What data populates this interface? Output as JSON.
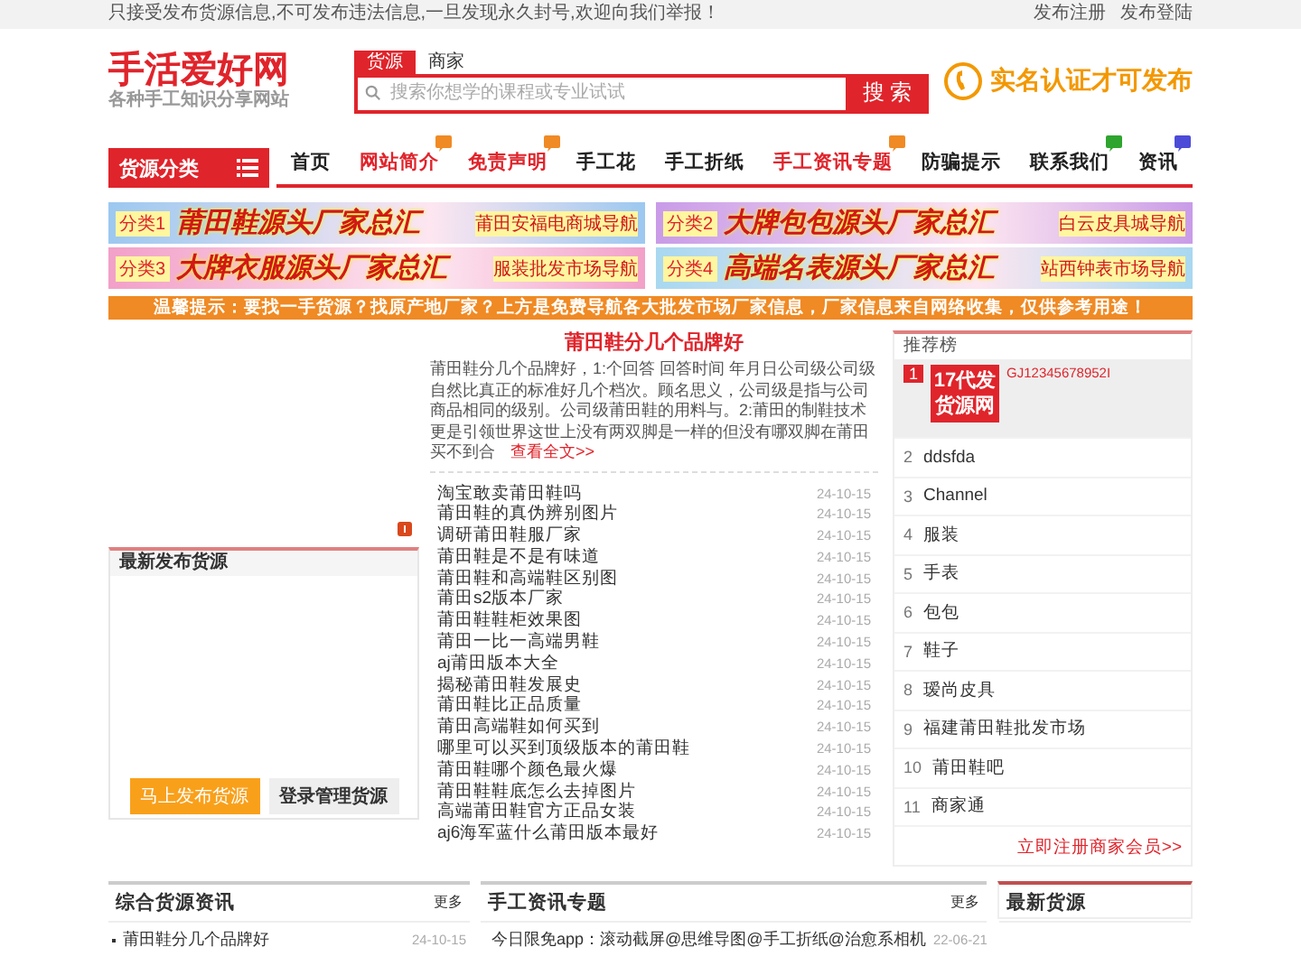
{
  "top_bar": {
    "notice": "只接受发布货源信息,不可发布违法信息,一旦发现永久封号,欢迎向我们举报！",
    "links": [
      "发布注册",
      "发布登陆"
    ]
  },
  "logo": {
    "title": "手活爱好网",
    "subtitle": "各种手工知识分享网站"
  },
  "search": {
    "tabs": [
      {
        "label": "货源",
        "selected": true
      },
      {
        "label": "商家",
        "selected": false
      }
    ],
    "placeholder": "搜索你想学的课程或专业试试",
    "button": "搜 索"
  },
  "slogan": "实名认证才可发布",
  "category_menu": "货源分类",
  "nav": [
    {
      "label": "首页",
      "highlighted": false
    },
    {
      "label": "网站简介",
      "highlighted": true,
      "color": "#f08a24"
    },
    {
      "label": "免责声明",
      "highlighted": true,
      "color": "#f08a24"
    },
    {
      "label": "手工花",
      "highlighted": false
    },
    {
      "label": "手工折纸",
      "highlighted": false
    },
    {
      "label": "手工资讯专题",
      "highlighted": true,
      "color": "#f08a24"
    },
    {
      "label": "防骗提示",
      "highlighted": false
    },
    {
      "label": "联系我们",
      "highlighted": false,
      "color": "#2ea52e"
    },
    {
      "label": "资讯",
      "highlighted": false,
      "color": "#4b4bd8"
    }
  ],
  "banners": [
    {
      "tag": "分类1",
      "title": "莆田鞋源头厂家总汇",
      "sub": "莆田安福电商城导航",
      "color": "#9cc8f0"
    },
    {
      "tag": "分类2",
      "title": "大牌包包源头厂家总汇",
      "sub": "白云皮具城导航",
      "color": "#c99be8"
    },
    {
      "tag": "分类3",
      "title": "大牌衣服源头厂家总汇",
      "sub": "服装批发市场导航",
      "color": "#f2a0c8"
    },
    {
      "tag": "分类4",
      "title": "高端名表源头厂家总汇",
      "sub": "站西钟表市场导航",
      "color": "#a8d8f0"
    }
  ],
  "notice_bar": "温馨提示：要找一手货源？找原产地厂家？上方是免费导航各大批发市场厂家信息，厂家信息来自网络收集，仅供参考用途！",
  "latest_box": {
    "title": "最新发布货源",
    "buttons": [
      "马上发布货源",
      "登录管理货源"
    ]
  },
  "article": {
    "title": "莆田鞋分几个品牌好",
    "summary": "莆田鞋分几个品牌好，1:个回答 回答时间 年月日公司级公司级自然比真正的标准好几个档次。顾名思义，公司级是指与公司商品相同的级别。公司级莆田鞋的用料与。2:莆田的制鞋技术更是引领世界这世上没有两双脚是一样的但没有哪双脚在莆田买不到合",
    "more": "查看全文>>"
  },
  "news": [
    {
      "title": "淘宝敢卖莆田鞋吗",
      "date": "24-10-15"
    },
    {
      "title": "莆田鞋的真伪辨别图片",
      "date": "24-10-15"
    },
    {
      "title": "调研莆田鞋服厂家",
      "date": "24-10-15"
    },
    {
      "title": "莆田鞋是不是有味道",
      "date": "24-10-15"
    },
    {
      "title": "莆田鞋和高端鞋区别图",
      "date": "24-10-15"
    },
    {
      "title": "莆田s2版本厂家",
      "date": "24-10-15"
    },
    {
      "title": "莆田鞋鞋柜效果图",
      "date": "24-10-15"
    },
    {
      "title": "莆田一比一高端男鞋",
      "date": "24-10-15"
    },
    {
      "title": "aj莆田版本大全",
      "date": "24-10-15"
    },
    {
      "title": "揭秘莆田鞋发展史",
      "date": "24-10-15"
    },
    {
      "title": "莆田鞋比正品质量",
      "date": "24-10-15"
    },
    {
      "title": "莆田高端鞋如何买到",
      "date": "24-10-15"
    },
    {
      "title": "哪里可以买到顶级版本的莆田鞋",
      "date": "24-10-15"
    },
    {
      "title": "莆田鞋哪个颜色最火爆",
      "date": "24-10-15"
    },
    {
      "title": "莆田鞋鞋底怎么去掉图片",
      "date": "24-10-15"
    },
    {
      "title": "高端莆田鞋官方正品女装",
      "date": "24-10-15"
    },
    {
      "title": "aj6海军蓝什么莆田版本最好",
      "date": "24-10-15"
    }
  ],
  "ranking": {
    "title": "推荐榜",
    "items": [
      {
        "rank": "1",
        "name": "GJ12345678952I",
        "logo": "17代发货源网",
        "highlighted": true
      },
      {
        "rank": "2",
        "name": "ddsfda",
        "highlighted": false
      },
      {
        "rank": "3",
        "name": "Channel",
        "highlighted": false
      },
      {
        "rank": "4",
        "name": "服装",
        "highlighted": false
      },
      {
        "rank": "5",
        "name": "手表",
        "highlighted": false
      },
      {
        "rank": "6",
        "name": "包包",
        "highlighted": false
      },
      {
        "rank": "7",
        "name": "鞋子",
        "highlighted": false
      },
      {
        "rank": "8",
        "name": "瑷尚皮具",
        "highlighted": false
      },
      {
        "rank": "9",
        "name": "福建莆田鞋批发市场",
        "highlighted": false
      },
      {
        "rank": "10",
        "name": "莆田鞋吧",
        "highlighted": false
      },
      {
        "rank": "11",
        "name": "商家通",
        "highlighted": false
      }
    ],
    "link": "立即注册商家会员>>"
  },
  "bottom_panels": [
    {
      "title": "综合货源资讯",
      "more": "更多",
      "items": [
        {
          "title": "莆田鞋分几个品牌好",
          "date": "24-10-15"
        }
      ]
    },
    {
      "title": "手工资讯专题",
      "more": "更多",
      "items": [
        {
          "title": "今日限免app：滚动截屏@思维导图@手工折纸@治愈系相机",
          "date": "22-06-21"
        }
      ]
    },
    {
      "title": "最新货源"
    }
  ]
}
